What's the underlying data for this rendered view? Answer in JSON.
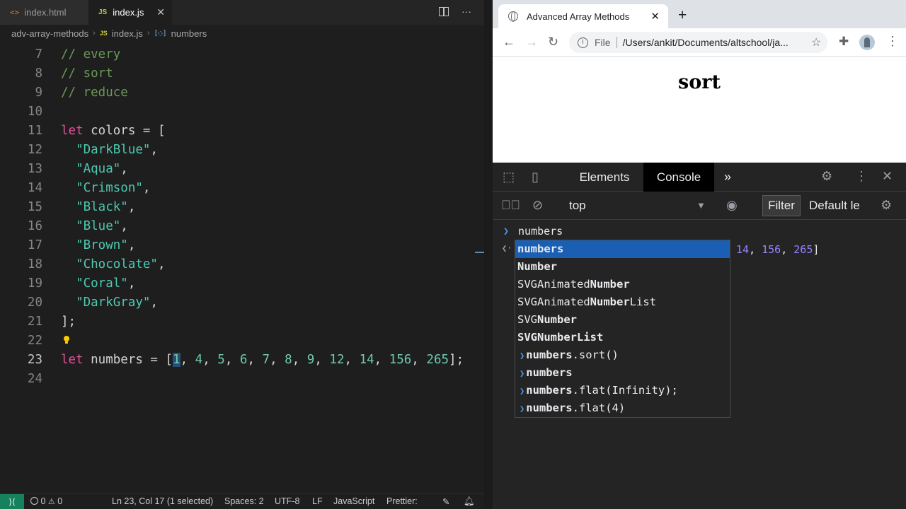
{
  "vscode": {
    "tabs": [
      {
        "label": "index.html",
        "icon": "html-file-icon"
      },
      {
        "label": "index.js",
        "icon": "js-file-icon"
      }
    ],
    "breadcrumb": [
      "adv-array-methods",
      "index.js",
      "numbers"
    ],
    "lines": [
      {
        "n": "7",
        "text": "// every"
      },
      {
        "n": "8",
        "text": "// sort"
      },
      {
        "n": "9",
        "text": "// reduce"
      },
      {
        "n": "10",
        "text": ""
      },
      {
        "n": "11",
        "kw": "let",
        "text": " colors = ["
      },
      {
        "n": "12",
        "str": "\"DarkBlue\"",
        "text": ","
      },
      {
        "n": "13",
        "str": "\"Aqua\"",
        "text": ","
      },
      {
        "n": "14",
        "str": "\"Crimson\"",
        "text": ","
      },
      {
        "n": "15",
        "str": "\"Black\"",
        "text": ","
      },
      {
        "n": "16",
        "str": "\"Blue\"",
        "text": ","
      },
      {
        "n": "17",
        "str": "\"Brown\"",
        "text": ","
      },
      {
        "n": "18",
        "str": "\"Chocolate\"",
        "text": ","
      },
      {
        "n": "19",
        "str": "\"Coral\"",
        "text": ","
      },
      {
        "n": "20",
        "str": "\"DarkGray\"",
        "text": ","
      },
      {
        "n": "21",
        "text": "];"
      },
      {
        "n": "22",
        "text": ""
      },
      {
        "n": "23",
        "kw": "let",
        "text": " numbers = ["
      },
      {
        "n": "24",
        "text": ""
      }
    ],
    "numbers_array": [
      "1",
      "4",
      "5",
      "6",
      "7",
      "8",
      "9",
      "12",
      "14",
      "156",
      "265"
    ],
    "numbers_close": "];",
    "status": {
      "errors": "0",
      "warnings": "0",
      "position": "Ln 23, Col 17 (1 selected)",
      "spaces": "Spaces: 2",
      "encoding": "UTF-8",
      "eol": "LF",
      "language": "JavaScript",
      "formatter": "Prettier:"
    }
  },
  "browser": {
    "tab_title": "Advanced Array Methods",
    "address_scheme": "File",
    "address_path": "/Users/ankit/Documents/altschool/ja...",
    "page_heading": "sort"
  },
  "devtools": {
    "tabs": [
      "Elements",
      "Console"
    ],
    "active_tab": "Console",
    "context": "top",
    "filter": "Filter",
    "levels": "Default le",
    "input": "numbers",
    "result_tail": [
      "14",
      "156",
      "265"
    ],
    "autocomplete": [
      {
        "pre": "numbers",
        "post": "",
        "history": false,
        "selected": true
      },
      {
        "pre": "Number",
        "post": "",
        "history": false,
        "selected": false
      },
      {
        "pre": "SVGAnimated",
        "mid": "Number",
        "post": "",
        "history": false,
        "selected": false
      },
      {
        "pre": "SVGAnimated",
        "mid": "Number",
        "post": "List",
        "history": false,
        "selected": false
      },
      {
        "pre": "SVG",
        "mid": "Number",
        "post": "",
        "history": false,
        "selected": false
      },
      {
        "pre": "SVGNumberList",
        "post": "",
        "history": false,
        "selected": false
      },
      {
        "pre": "numbers",
        "post": ".sort()",
        "history": true,
        "selected": false
      },
      {
        "pre": "numbers",
        "post": "",
        "history": true,
        "selected": false
      },
      {
        "pre": "numbers",
        "post": ".flat(Infinity);",
        "history": true,
        "selected": false
      },
      {
        "pre": "numbers",
        "post": ".flat(4)",
        "history": true,
        "selected": false
      }
    ]
  }
}
